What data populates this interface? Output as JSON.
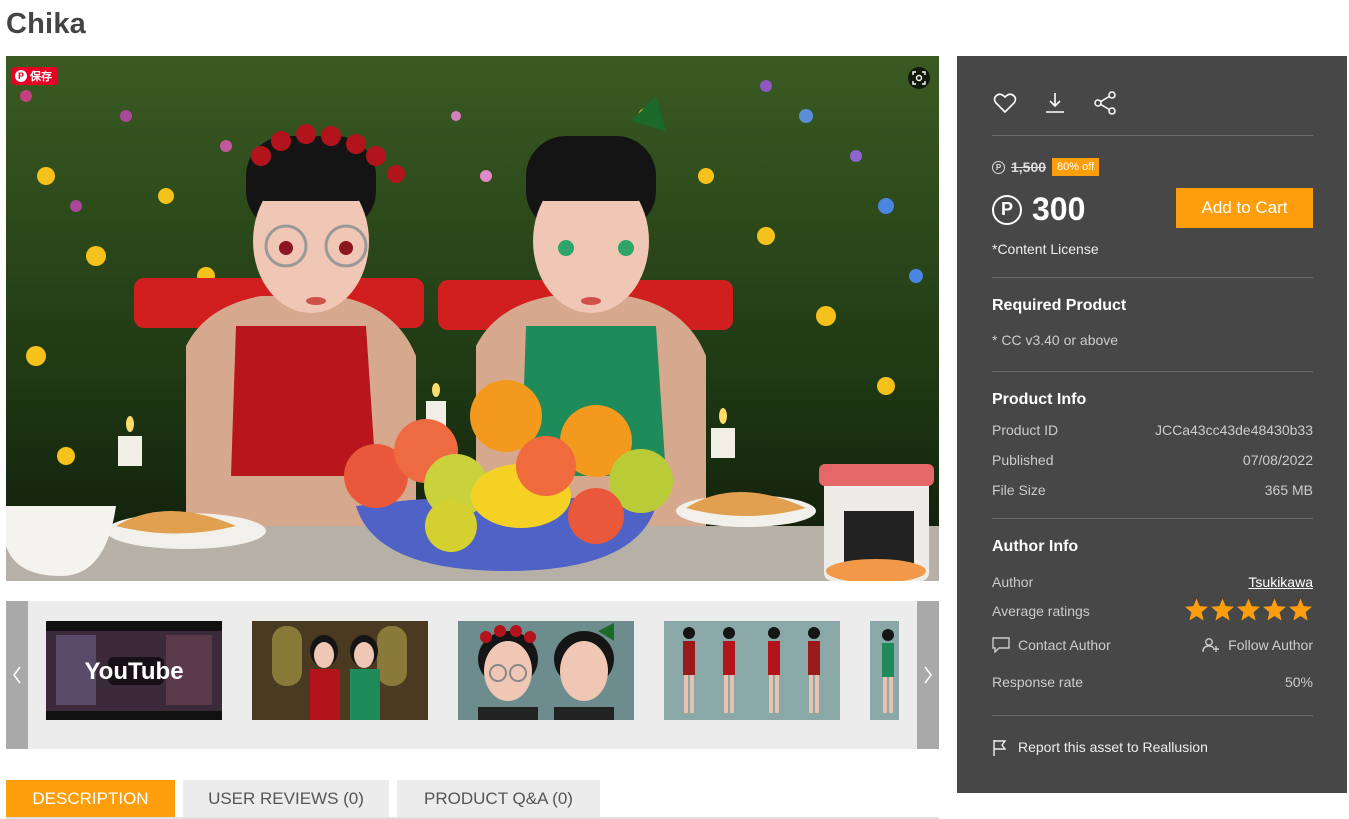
{
  "page": {
    "title": "Chika"
  },
  "hero": {
    "pin_label": "保存"
  },
  "thumbnails": [
    {
      "name": "thumb-youtube-video",
      "label": "YouTube"
    },
    {
      "name": "thumb-cathedral"
    },
    {
      "name": "thumb-closeup"
    },
    {
      "name": "thumb-full-body"
    },
    {
      "name": "thumb-partial"
    }
  ],
  "tabs": [
    {
      "label": "DESCRIPTION",
      "active": true
    },
    {
      "label": "USER REVIEWS (0)",
      "active": false
    },
    {
      "label": "PRODUCT Q&A (0)",
      "active": false
    }
  ],
  "pricing": {
    "coin_symbol": "P",
    "original_price": "1,500",
    "discount": "80% off",
    "price": "300",
    "cart_label": "Add to Cart",
    "license_label": "*Content License"
  },
  "required": {
    "title": "Required Product",
    "text": "* CC v3.40 or above"
  },
  "product_info": {
    "title": "Product Info",
    "rows": [
      {
        "label": "Product ID",
        "value": "JCCa43cc43de48430b33"
      },
      {
        "label": "Published",
        "value": "07/08/2022"
      },
      {
        "label": "File Size",
        "value": "365 MB"
      }
    ]
  },
  "author_info": {
    "title": "Author Info",
    "author_label": "Author",
    "author_name": "Tsukikawa",
    "rating_label": "Average ratings",
    "rating": 5,
    "contact_label": "Contact Author",
    "follow_label": "Follow Author",
    "response_label": "Response rate",
    "response_value": "50%"
  },
  "report_label": "Report this asset to Reallusion",
  "colors": {
    "accent": "#ff9e0d",
    "panel": "#474747",
    "star": "#ff9e0d"
  }
}
